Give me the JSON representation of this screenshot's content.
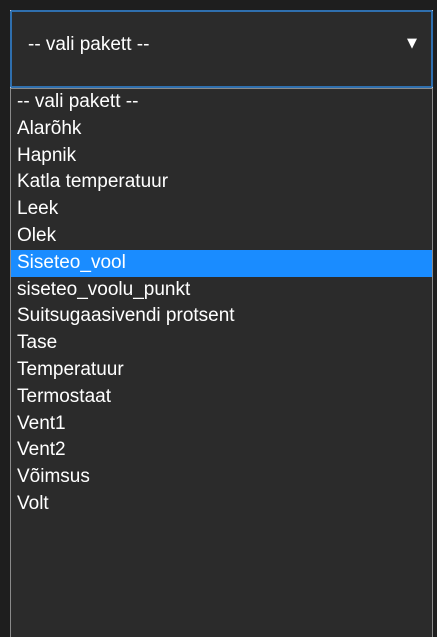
{
  "select": {
    "current_value": "-- vali pakett --",
    "arrow_icon": "triangle-down-icon",
    "highlighted_option": "Siseteo_vool",
    "options": [
      "-- vali pakett --",
      "Alarõhk",
      "Hapnik",
      "Katla temperatuur",
      "Leek",
      "Olek",
      "Siseteo_vool",
      "siseteo_voolu_punkt",
      "Suitsugaasivendi protsent",
      "Tase",
      "Temperatuur",
      "Termostaat",
      "Vent1",
      "Vent2",
      "Võimsus",
      "Volt"
    ]
  },
  "colors": {
    "background": "#2b2b2b",
    "highlight": "#1a8cff",
    "focus_border": "#2f6fae",
    "text": "#ffffff"
  }
}
